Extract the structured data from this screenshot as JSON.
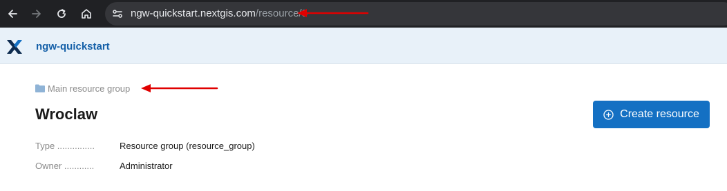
{
  "browser": {
    "url_host": "ngw-quickstart.nextgis.com",
    "url_path": "/resource/3"
  },
  "header": {
    "app_title": "ngw-quickstart"
  },
  "breadcrumb": {
    "label": "Main resource group"
  },
  "page": {
    "title": "Wroclaw",
    "create_button_label": "Create resource"
  },
  "metadata": {
    "type_label": "Type",
    "type_value": "Resource group (resource_group)",
    "owner_label": "Owner",
    "owner_value": "Administrator"
  },
  "colors": {
    "primary": "#1470c3",
    "header_bg": "#e8f1f9",
    "annotation": "#e00000"
  }
}
